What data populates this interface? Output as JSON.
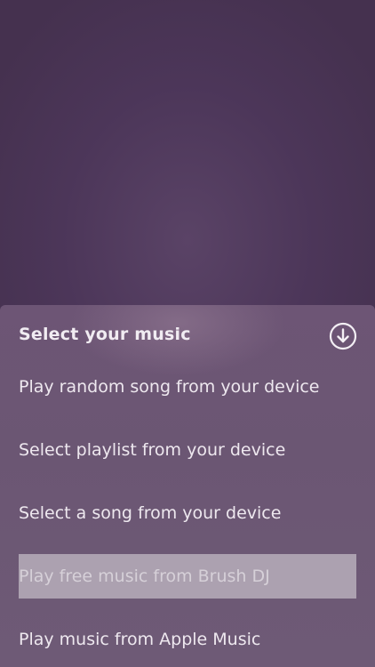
{
  "sheet": {
    "title": "Select your music",
    "download_icon": "download-arrow-circle-icon",
    "options": [
      {
        "label": "Play random song from your device"
      },
      {
        "label": "Select playlist from your device"
      },
      {
        "label": "Select a song from your device"
      },
      {
        "label": "Play free music from Brush DJ",
        "selected": true
      },
      {
        "label": "Play music from Apple Music"
      }
    ]
  },
  "colors": {
    "background": "#4a3554",
    "sheet": "#6d5575",
    "selected_row": "#aca1b0",
    "text": "#f1ecf2"
  }
}
